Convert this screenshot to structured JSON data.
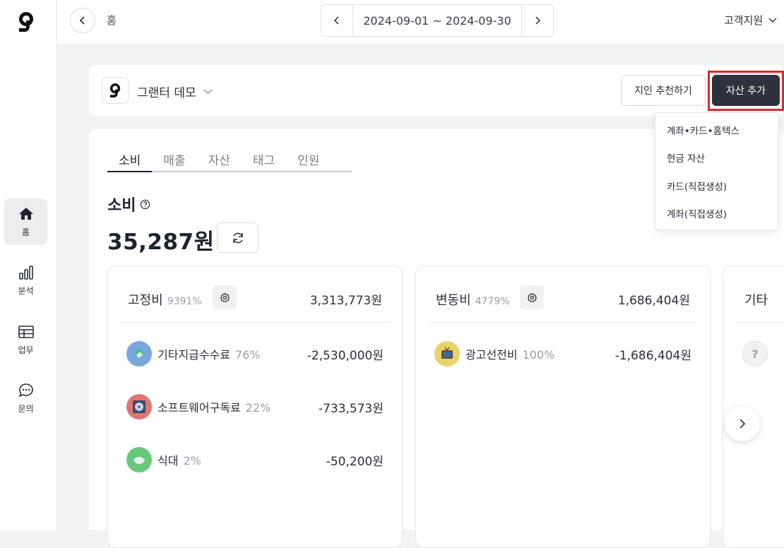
{
  "sidebar": {
    "logo": "g-logo",
    "items": [
      {
        "label": "홈",
        "icon": "home-icon",
        "active": true
      },
      {
        "label": "분석",
        "icon": "bar-chart-icon"
      },
      {
        "label": "업무",
        "icon": "table-icon"
      },
      {
        "label": "문의",
        "icon": "chat-icon"
      }
    ]
  },
  "topbar": {
    "breadcrumb": "홈",
    "date_range": "2024-09-01 ~ 2024-09-30",
    "support": "고객지원"
  },
  "header": {
    "org_name": "그랜터 데모",
    "recommend_button": "지인 추천하기",
    "add_asset_button": "자산 추가"
  },
  "dropdown": {
    "items": [
      "계좌•카드•홈텍스",
      "현금 자산",
      "카드(직접생성)",
      "계좌(직접생성)"
    ]
  },
  "main": {
    "tabs": [
      "소비",
      "매출",
      "자산",
      "태그",
      "인원"
    ],
    "section_title": "소비",
    "total": "35,287원",
    "cards": [
      {
        "title": "고정비",
        "percent": "9391%",
        "amount": "3,313,773원",
        "rows": [
          {
            "name": "기타지급수수료",
            "percent": "76%",
            "value": "-2,530,000원",
            "color": "#7aa6e0"
          },
          {
            "name": "소프트웨어구독료",
            "percent": "22%",
            "value": "-733,573원",
            "color": "#e57373"
          },
          {
            "name": "식대",
            "percent": "2%",
            "value": "-50,200원",
            "color": "#66c97a"
          }
        ]
      },
      {
        "title": "변동비",
        "percent": "4779%",
        "amount": "1,686,404원",
        "rows": [
          {
            "name": "광고선전비",
            "percent": "100%",
            "value": "-1,686,404원",
            "color": "#e8d36a"
          }
        ]
      },
      {
        "title": "기타"
      }
    ]
  },
  "colors": {
    "accent_dark": "#2e323c",
    "highlight": "#e0262b"
  }
}
